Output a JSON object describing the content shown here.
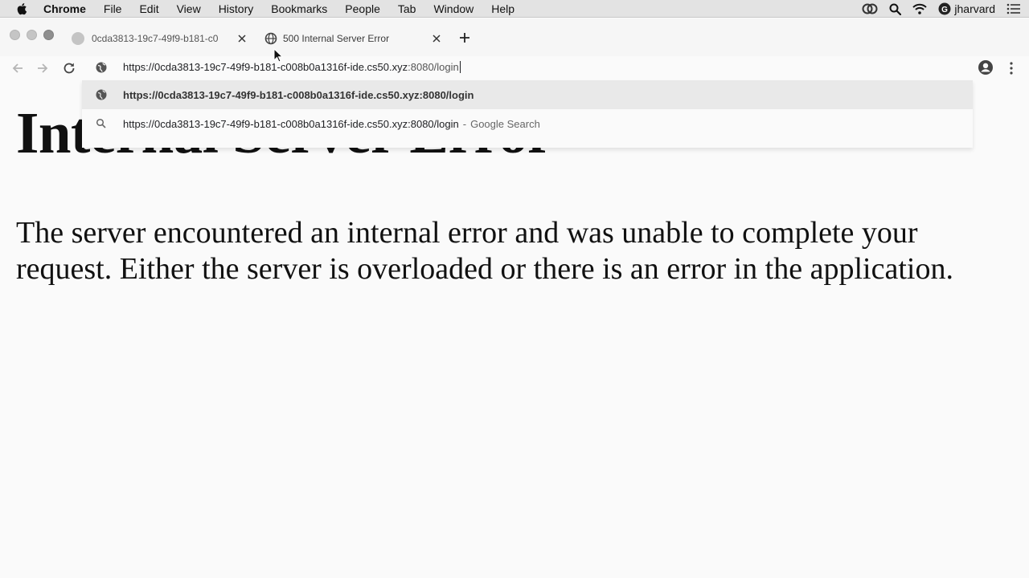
{
  "menubar": {
    "app": "Chrome",
    "items": [
      "File",
      "Edit",
      "View",
      "History",
      "Bookmarks",
      "People",
      "Tab",
      "Window",
      "Help"
    ],
    "user": "jharvard"
  },
  "tabs": [
    {
      "title": "0cda3813-19c7-49f9-b181-c0",
      "favicon": "blank-favicon",
      "active": false
    },
    {
      "title": "500 Internal Server Error",
      "favicon": "globe-icon",
      "active": true
    }
  ],
  "omnibox": {
    "url_main": "https://0cda3813-19c7-49f9-b181-c008b0a1316f-ide.cs50.xyz",
    "url_rest": ":8080/login"
  },
  "suggestions": [
    {
      "icon": "globe-icon",
      "text": "https://0cda3813-19c7-49f9-b181-c008b0a1316f-ide.cs50.xyz:8080/login",
      "description": ""
    },
    {
      "icon": "search-icon",
      "text": "https://0cda3813-19c7-49f9-b181-c008b0a1316f-ide.cs50.xyz:8080/login",
      "description": "Google Search"
    }
  ],
  "page": {
    "heading": "Internal Server Error",
    "message": "The server encountered an internal error and was unable to complete your request. Either the server is overloaded or there is an error in the application."
  }
}
